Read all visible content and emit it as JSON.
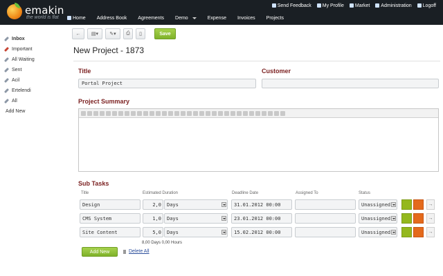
{
  "brand": {
    "name": "emakin",
    "tagline": "the world is flat"
  },
  "top_links": [
    {
      "label": "Send Feedback",
      "icon": "feedback-icon"
    },
    {
      "label": "My Profile",
      "icon": "user-icon"
    },
    {
      "label": "Market",
      "icon": "cart-icon"
    },
    {
      "label": "Administration",
      "icon": "admin-icon"
    },
    {
      "label": "Logoff",
      "icon": "power-icon"
    }
  ],
  "nav": [
    "Home",
    "Address Book",
    "Agreements",
    "Demo",
    "Expense",
    "Invoices",
    "Projects"
  ],
  "sidebar": {
    "items": [
      "Inbox",
      "Important",
      "All Waiting",
      "Sent",
      "Acil",
      "Ertelendi",
      "All"
    ],
    "add_new": "Add New"
  },
  "toolbar": {
    "save_label": "Save"
  },
  "page": {
    "title": "New Project - 1873"
  },
  "form": {
    "title_label": "Title",
    "title_value": "Portal Project",
    "customer_label": "Customer",
    "customer_value": "",
    "summary_label": "Project Summary"
  },
  "subtasks": {
    "label": "Sub Tasks",
    "columns": [
      "Title",
      "Estimated Duration",
      "Deadline Date",
      "Assigned To",
      "Status"
    ],
    "rows": [
      {
        "title": "Design",
        "duration": "2,0",
        "unit": "Days",
        "deadline": "31.01.2012 00:00",
        "assigned": "",
        "status": "Unassigned"
      },
      {
        "title": "CMS System",
        "duration": "1,0",
        "unit": "Days",
        "deadline": "23.01.2012 00:00",
        "assigned": "",
        "status": "Unassigned"
      },
      {
        "title": "Site Content",
        "duration": "5,0",
        "unit": "Days",
        "deadline": "15.02.2012 00:00",
        "assigned": "",
        "status": "Unassigned"
      }
    ],
    "total": "8,00 Days 0,00 Hours",
    "add_new": "Add New",
    "delete_all": "Delete All"
  },
  "colors": {
    "topbar": "#1a1f24",
    "accent_green": "#8cc232",
    "accent_orange": "#e46a1c",
    "section_label": "#7a1f1f"
  }
}
